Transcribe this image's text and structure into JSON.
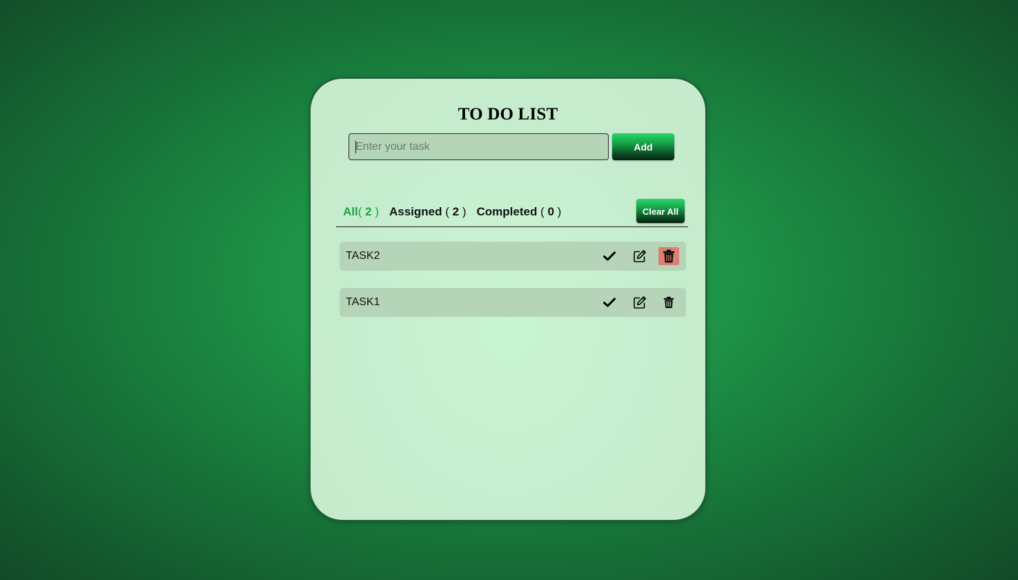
{
  "app": {
    "title": "TO DO LIST"
  },
  "input": {
    "placeholder": "Enter your task",
    "value": ""
  },
  "add_button": {
    "label": "Add"
  },
  "tabs": [
    {
      "name": "All",
      "open": "( ",
      "count": "2",
      "close": " )",
      "active": true
    },
    {
      "name": "Assigned",
      "open": " ( ",
      "count": "2",
      "close": " )",
      "active": false
    },
    {
      "name": "Completed",
      "open": " ( ",
      "count": "0",
      "close": " )",
      "active": false
    }
  ],
  "clear_button": {
    "label": "Clear All"
  },
  "tasks": [
    {
      "text": "TASK2",
      "icons": [
        "check-icon",
        "edit-icon",
        "trash-icon"
      ],
      "delete_highlighted": true
    },
    {
      "text": "TASK1",
      "icons": [
        "check-icon",
        "edit-icon",
        "trash-icon"
      ],
      "delete_highlighted": false
    }
  ],
  "colors": {
    "accent": "#1ea243",
    "delete_hover": "#d98073",
    "task_bg": "#b6d4b7",
    "card_bg": "#c6ecce"
  }
}
